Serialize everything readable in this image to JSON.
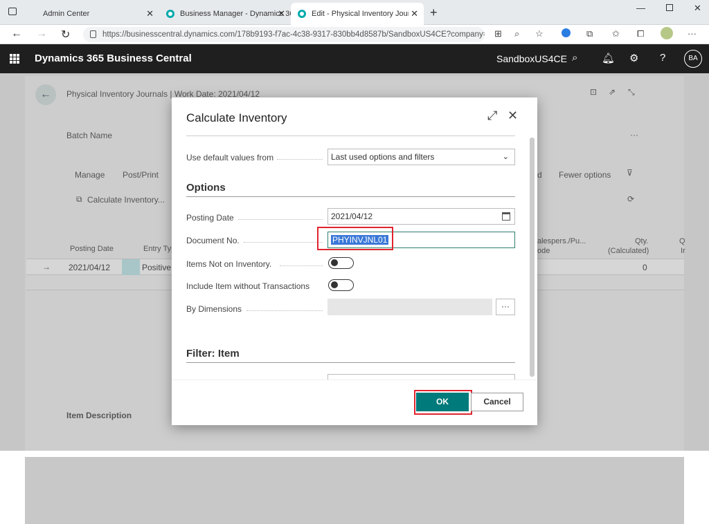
{
  "browser": {
    "tabs": [
      {
        "title": "Admin Center"
      },
      {
        "title": "Business Manager - Dynamics 36"
      },
      {
        "title": "Edit - Physical Inventory Journals"
      }
    ],
    "new_tab": "+",
    "url": "https://businesscentral.dynamics.com/178b9193-f7ac-4c38-9317-830bb4d8587b/SandboxUS4CE?company=..."
  },
  "app": {
    "name": "Dynamics 365 Business Central",
    "environment": "SandboxUS4CE",
    "avatar": "BA"
  },
  "page": {
    "breadcrumb": "Physical Inventory Journals | Work Date: 2021/04/12",
    "batch_label": "Batch Name",
    "actions": [
      "Manage",
      "Post/Print"
    ],
    "action_tail": "d",
    "fewer_options": "Fewer options",
    "calc_action": "Calculate Inventory...",
    "columns": {
      "posting_date": "Posting Date",
      "entry_type": "Entry Typ",
      "salesperson": "alespers./Pu...",
      "salesperson2": "ode",
      "qty_calc": "Qty.",
      "qty_calc2": "(Calculated)",
      "q": "Q",
      "q2": "Ir"
    },
    "row": {
      "arrow": "→",
      "posting_date": "2021/04/12",
      "entry_type": "Positive",
      "qty": "0"
    },
    "item_description": "Item Description",
    "ellipsis": "···"
  },
  "modal": {
    "title": "Calculate Inventory",
    "use_default_label": "Use default values from",
    "use_default_value": "Last used options and filters",
    "options_header": "Options",
    "posting_date_label": "Posting Date",
    "posting_date_value": "2021/04/12",
    "document_no_label": "Document No.",
    "document_no_value": "PHYINVJNL01",
    "items_not_on_inventory_label": "Items Not on Inventory.",
    "include_item_label": "Include Item without Transactions",
    "by_dimensions_label": "By Dimensions",
    "by_dimensions_button": "···",
    "filter_header": "Filter: Item",
    "ok": "OK",
    "cancel": "Cancel"
  }
}
